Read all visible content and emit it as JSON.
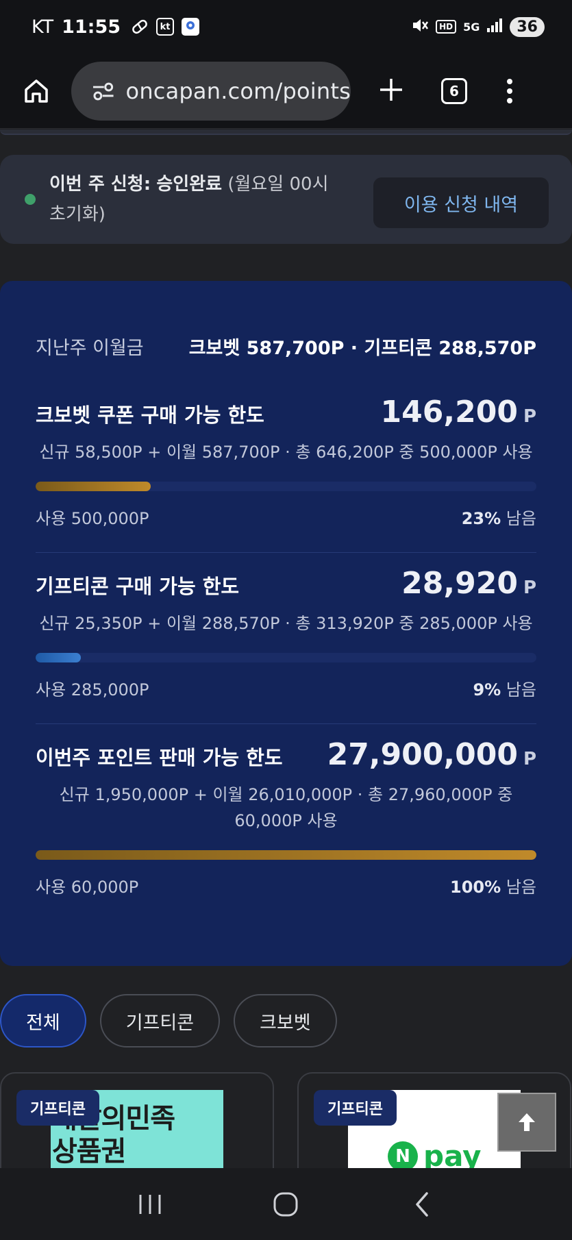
{
  "status_bar": {
    "carrier": "KT",
    "time": "11:55",
    "battery": "36",
    "net": "5G"
  },
  "browser": {
    "url": "oncapan.com/points",
    "tab_count": "6"
  },
  "weekly_status": {
    "label": "이번 주 신청:",
    "value": "승인완료",
    "note": "(월요일 00시 초기화)",
    "history_button": "이용 신청 내역"
  },
  "carryover": {
    "label": "지난주 이월금",
    "value": "크보벳 587,700P · 기프티콘 288,570P"
  },
  "limits": [
    {
      "title": "크보벳 쿠폰 구매 가능 한도",
      "amount": "146,200",
      "unit": "P",
      "detail": "신규 58,500P + 이월 587,700P · 총 646,200P 중 500,000P 사용",
      "used": "사용 500,000P",
      "remaining_pct": "23%",
      "remaining_label": "남음",
      "fill_fraction": 0.23,
      "color": "#c08a2a"
    },
    {
      "title": "기프티콘 구매 가능 한도",
      "amount": "28,920",
      "unit": "P",
      "detail": "신규 25,350P + 이월 288,570P · 총 313,920P 중 285,000P 사용",
      "used": "사용 285,000P",
      "remaining_pct": "9%",
      "remaining_label": "남음",
      "fill_fraction": 0.09,
      "color": "#3b7fd0"
    },
    {
      "title": "이번주 포인트 판매 가능 한도",
      "amount": "27,900,000",
      "unit": "P",
      "detail": "신규 1,950,000P + 이월 26,010,000P · 총 27,960,000P 중 60,000P 사용",
      "used": "사용 60,000P",
      "remaining_pct": "100%",
      "remaining_label": "남음",
      "fill_fraction": 1.0,
      "color": "#c08a2a"
    }
  ],
  "filters": [
    "전체",
    "기프티콘",
    "크보벳"
  ],
  "active_filter": "전체",
  "products": [
    {
      "badge": "기프티콘",
      "image_text_1": "배달의민족",
      "image_text_2": "상품권"
    },
    {
      "badge": "기프티콘",
      "image_text_1": "N",
      "image_text_2": "pay"
    }
  ]
}
